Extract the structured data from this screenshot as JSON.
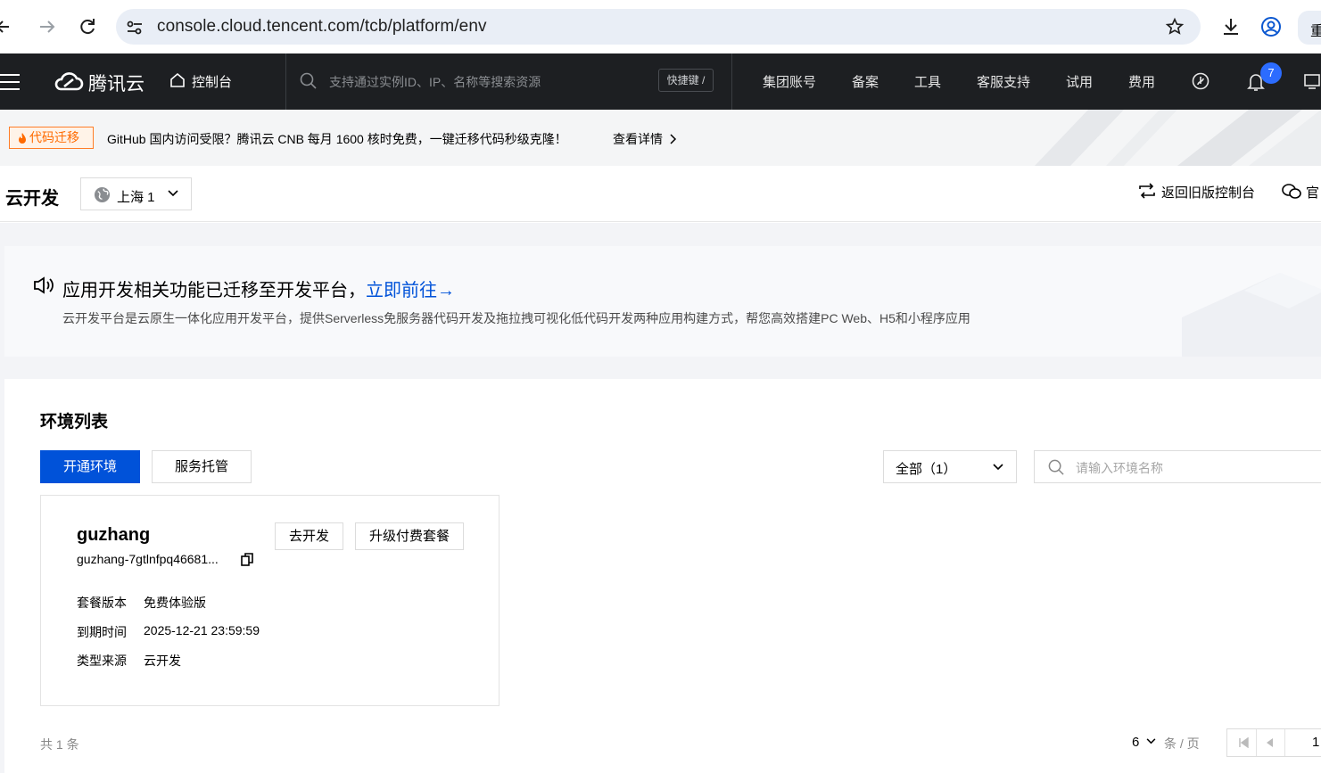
{
  "browser": {
    "url": "console.cloud.tencent.com/tcb/platform/env",
    "edge_char": "重"
  },
  "header": {
    "brand": "腾讯云",
    "console": "控制台",
    "search_placeholder": "支持通过实例ID、IP、名称等搜索资源",
    "shortcut": "快捷键 /",
    "nav": [
      "集团账号",
      "备案",
      "工具",
      "客服支持",
      "试用",
      "费用"
    ],
    "notification_count": "7"
  },
  "promo": {
    "tag": "代码迁移",
    "text": "GitHub 国内访问受限？腾讯云 CNB 每月 1600 核时免费，一键迁移代码秒级克隆！",
    "link": "查看详情"
  },
  "page": {
    "title": "云开发",
    "region": "上海 1",
    "old_console": "返回旧版控制台",
    "right_cut": "官"
  },
  "notice": {
    "title": "应用开发相关功能已迁移至开发平台，",
    "link": "立即前往→",
    "desc": "云开发平台是云原生一体化应用开发平台，提供Serverless免服务器代码开发及拖拉拽可视化低代码开发两种应用构建方式，帮您高效搭建PC Web、H5和小程序应用"
  },
  "env_list": {
    "title": "环境列表",
    "create_button": "开通环境",
    "hosting_button": "服务托管",
    "filter": "全部（1）",
    "search_placeholder": "请输入环境名称",
    "card": {
      "name": "guzhang",
      "id": "guzhang-7gtlnfpq46681...",
      "develop_button": "去开发",
      "upgrade_button": "升级付费套餐",
      "fields": [
        {
          "label": "套餐版本",
          "value": "免费体验版"
        },
        {
          "label": "到期时间",
          "value": "2025-12-21 23:59:59"
        },
        {
          "label": "类型来源",
          "value": "云开发"
        }
      ]
    },
    "total": "共 1 条",
    "page_size": "6",
    "page_unit": "条 / 页",
    "page_number": "1"
  },
  "colors": {
    "primary": "#0052d9",
    "header_bg": "#1d1f22",
    "promo_orange": "#ff6a00",
    "badge": "#2c6cff"
  }
}
